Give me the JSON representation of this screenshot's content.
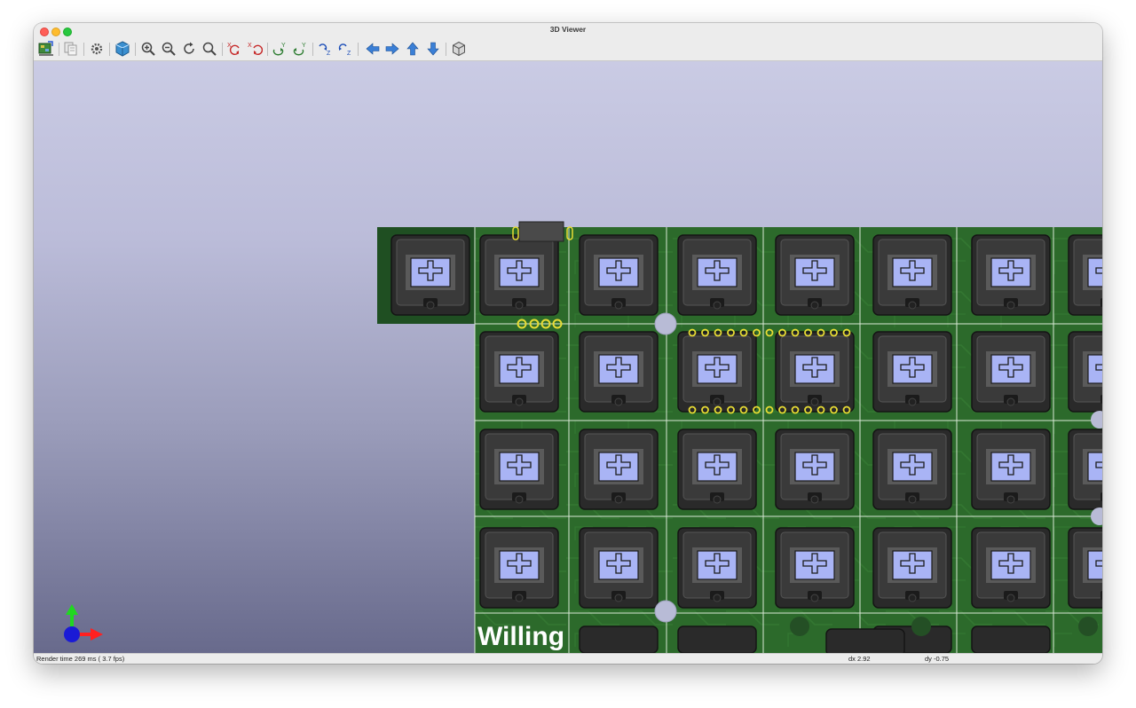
{
  "window": {
    "title": "3D Viewer"
  },
  "toolbar": {
    "buttons": [
      {
        "name": "reload-board-icon",
        "tooltip": "Reload board"
      },
      {
        "name": "copy-image-icon",
        "tooltip": "Copy 3D image to clipboard"
      },
      {
        "name": "settings-gear-icon",
        "tooltip": "3D display options"
      },
      {
        "name": "raytrace-cube-icon",
        "tooltip": "Render ray tracing"
      },
      {
        "name": "zoom-in-icon",
        "tooltip": "Zoom in"
      },
      {
        "name": "zoom-out-icon",
        "tooltip": "Zoom out"
      },
      {
        "name": "refresh-icon",
        "tooltip": "Redraw"
      },
      {
        "name": "zoom-fit-icon",
        "tooltip": "Zoom to fit"
      },
      {
        "name": "rotate-x-cw-icon",
        "tooltip": "Rotate X clockwise"
      },
      {
        "name": "rotate-x-ccw-icon",
        "tooltip": "Rotate X counterclockwise"
      },
      {
        "name": "rotate-y-cw-icon",
        "tooltip": "Rotate Y clockwise"
      },
      {
        "name": "rotate-y-ccw-icon",
        "tooltip": "Rotate Y counterclockwise"
      },
      {
        "name": "rotate-z-cw-icon",
        "tooltip": "Rotate Z clockwise"
      },
      {
        "name": "rotate-z-ccw-icon",
        "tooltip": "Rotate Z counterclockwise"
      },
      {
        "name": "arrow-left-icon",
        "tooltip": "Pan left"
      },
      {
        "name": "arrow-right-icon",
        "tooltip": "Pan right"
      },
      {
        "name": "arrow-up-icon",
        "tooltip": "Pan up"
      },
      {
        "name": "arrow-down-icon",
        "tooltip": "Pan down"
      },
      {
        "name": "ortho-cube-icon",
        "tooltip": "Orthographic projection"
      }
    ]
  },
  "scene": {
    "silkscreen_text": "Willing",
    "switch_marking": "CHERRY"
  },
  "colors": {
    "pcb": "#2c6a2b",
    "pcb_dark": "#1f4f22",
    "keycap_plate": "#a9b4f5",
    "axis_x": "#ff2020",
    "axis_y": "#20d820",
    "axis_z": "#1a1ad6"
  },
  "status": {
    "render": "Render time 269 ms ( 3.7 fps)",
    "dx": "dx 2.92",
    "dy": "dy -0.75"
  }
}
